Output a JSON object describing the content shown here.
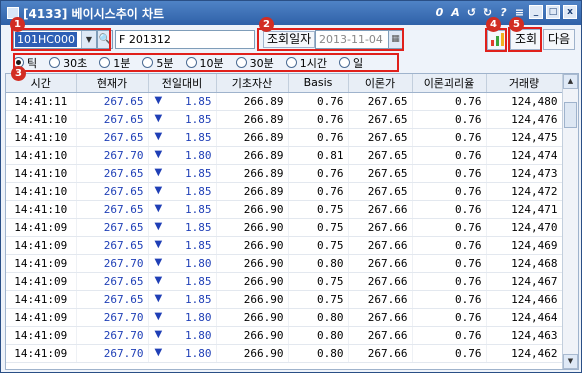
{
  "window": {
    "title": "[4133] 베이시스추이 차트",
    "tool_icons": [
      "0",
      "A",
      "↺",
      "↻",
      "?",
      "≡"
    ],
    "min_label": "_",
    "max_label": "□",
    "close_label": "x"
  },
  "toolbar": {
    "code_value": "101HC000",
    "name_value": "F 201312",
    "date_label": "조회일자",
    "date_value": "2013-11-04",
    "query_label": "조회",
    "next_label": "다음",
    "chart_colors": [
      "#e23b2b",
      "#3aa33a",
      "#f2b01e"
    ]
  },
  "badges": [
    "1",
    "2",
    "3",
    "4",
    "5"
  ],
  "periods": {
    "selected": "틱",
    "options": [
      "틱",
      "30초",
      "1분",
      "5분",
      "10분",
      "30분",
      "1시간",
      "일"
    ]
  },
  "grid": {
    "columns": [
      "시간",
      "현재가",
      "전일대비",
      "기초자산",
      "Basis",
      "이론가",
      "이론괴리율",
      "거래량"
    ],
    "rows": [
      {
        "time": "14:41:11",
        "price": "267.65",
        "dir": "▼",
        "change": "1.85",
        "underlying": "266.89",
        "basis": "0.76",
        "theory": "267.65",
        "gap": "0.76",
        "volume": "124,480"
      },
      {
        "time": "14:41:10",
        "price": "267.65",
        "dir": "▼",
        "change": "1.85",
        "underlying": "266.89",
        "basis": "0.76",
        "theory": "267.65",
        "gap": "0.76",
        "volume": "124,476"
      },
      {
        "time": "14:41:10",
        "price": "267.65",
        "dir": "▼",
        "change": "1.85",
        "underlying": "266.89",
        "basis": "0.76",
        "theory": "267.65",
        "gap": "0.76",
        "volume": "124,475"
      },
      {
        "time": "14:41:10",
        "price": "267.70",
        "dir": "▼",
        "change": "1.80",
        "underlying": "266.89",
        "basis": "0.81",
        "theory": "267.65",
        "gap": "0.76",
        "volume": "124,474"
      },
      {
        "time": "14:41:10",
        "price": "267.65",
        "dir": "▼",
        "change": "1.85",
        "underlying": "266.89",
        "basis": "0.76",
        "theory": "267.65",
        "gap": "0.76",
        "volume": "124,473"
      },
      {
        "time": "14:41:10",
        "price": "267.65",
        "dir": "▼",
        "change": "1.85",
        "underlying": "266.89",
        "basis": "0.76",
        "theory": "267.65",
        "gap": "0.76",
        "volume": "124,472"
      },
      {
        "time": "14:41:10",
        "price": "267.65",
        "dir": "▼",
        "change": "1.85",
        "underlying": "266.90",
        "basis": "0.75",
        "theory": "267.66",
        "gap": "0.76",
        "volume": "124,471"
      },
      {
        "time": "14:41:09",
        "price": "267.65",
        "dir": "▼",
        "change": "1.85",
        "underlying": "266.90",
        "basis": "0.75",
        "theory": "267.66",
        "gap": "0.76",
        "volume": "124,470"
      },
      {
        "time": "14:41:09",
        "price": "267.65",
        "dir": "▼",
        "change": "1.85",
        "underlying": "266.90",
        "basis": "0.75",
        "theory": "267.66",
        "gap": "0.76",
        "volume": "124,469"
      },
      {
        "time": "14:41:09",
        "price": "267.70",
        "dir": "▼",
        "change": "1.80",
        "underlying": "266.90",
        "basis": "0.80",
        "theory": "267.66",
        "gap": "0.76",
        "volume": "124,468"
      },
      {
        "time": "14:41:09",
        "price": "267.65",
        "dir": "▼",
        "change": "1.85",
        "underlying": "266.90",
        "basis": "0.75",
        "theory": "267.66",
        "gap": "0.76",
        "volume": "124,467"
      },
      {
        "time": "14:41:09",
        "price": "267.65",
        "dir": "▼",
        "change": "1.85",
        "underlying": "266.90",
        "basis": "0.75",
        "theory": "267.66",
        "gap": "0.76",
        "volume": "124,466"
      },
      {
        "time": "14:41:09",
        "price": "267.70",
        "dir": "▼",
        "change": "1.80",
        "underlying": "266.90",
        "basis": "0.80",
        "theory": "267.66",
        "gap": "0.76",
        "volume": "124,464"
      },
      {
        "time": "14:41:09",
        "price": "267.70",
        "dir": "▼",
        "change": "1.80",
        "underlying": "266.90",
        "basis": "0.80",
        "theory": "267.66",
        "gap": "0.76",
        "volume": "124,463"
      },
      {
        "time": "14:41:09",
        "price": "267.70",
        "dir": "▼",
        "change": "1.80",
        "underlying": "266.90",
        "basis": "0.80",
        "theory": "267.66",
        "gap": "0.76",
        "volume": "124,462"
      }
    ]
  }
}
